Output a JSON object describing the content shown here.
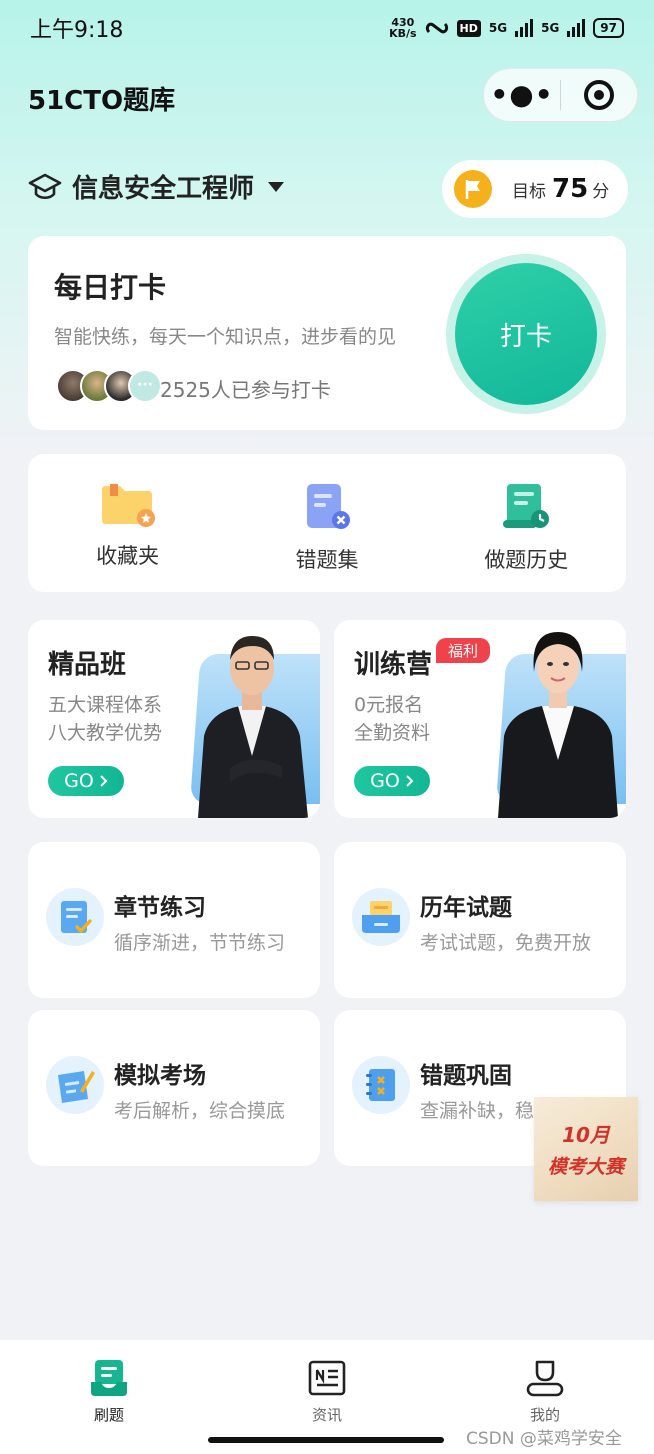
{
  "status": {
    "time": "上午9:18",
    "speed_value": "430",
    "speed_unit": "KB/s",
    "hd": "HD",
    "net1": "5G",
    "net2": "5G",
    "battery": "97"
  },
  "app": {
    "title": "51CTO题库",
    "more_icon": "•●•"
  },
  "exam": {
    "name": "信息安全工程师"
  },
  "goal": {
    "label": "目标",
    "score": "75",
    "unit": "分"
  },
  "checkin": {
    "title": "每日打卡",
    "desc": "智能快练，每天一个知识点，进步看的见",
    "count": "2525人已参与打卡",
    "button": "打卡",
    "more_dots": "···"
  },
  "tools": [
    {
      "label": "收藏夹",
      "icon": "folder-star-icon"
    },
    {
      "label": "错题集",
      "icon": "wrong-doc-icon"
    },
    {
      "label": "做题历史",
      "icon": "history-scroll-icon"
    }
  ],
  "promos": [
    {
      "title": "精品班",
      "line1": "五大课程体系",
      "line2": "八大教学优势",
      "go": "GO"
    },
    {
      "title": "训练营",
      "badge": "福利",
      "line1": "0元报名",
      "line2": "全勤资料",
      "go": "GO"
    }
  ],
  "features": [
    {
      "title": "章节练习",
      "desc": "循序渐进，节节练习",
      "icon": "chapter-icon"
    },
    {
      "title": "历年试题",
      "desc": "考试试题，免费开放",
      "icon": "past-papers-icon"
    },
    {
      "title": "模拟考场",
      "desc": "考后解析，综合摸底",
      "icon": "mock-exam-icon"
    },
    {
      "title": "错题巩固",
      "desc": "查漏补缺，稳",
      "icon": "wrong-review-icon"
    }
  ],
  "ad": {
    "line1": "10月",
    "line2": "模考大赛"
  },
  "tabs": [
    {
      "label": "刷题",
      "active": true
    },
    {
      "label": "资讯",
      "active": false
    },
    {
      "label": "我的",
      "active": false
    }
  ],
  "watermark": "CSDN @菜鸡学安全",
  "colors": {
    "accent": "#12b694",
    "badge": "#f0424b",
    "goal_flag": "#f5b11c"
  }
}
